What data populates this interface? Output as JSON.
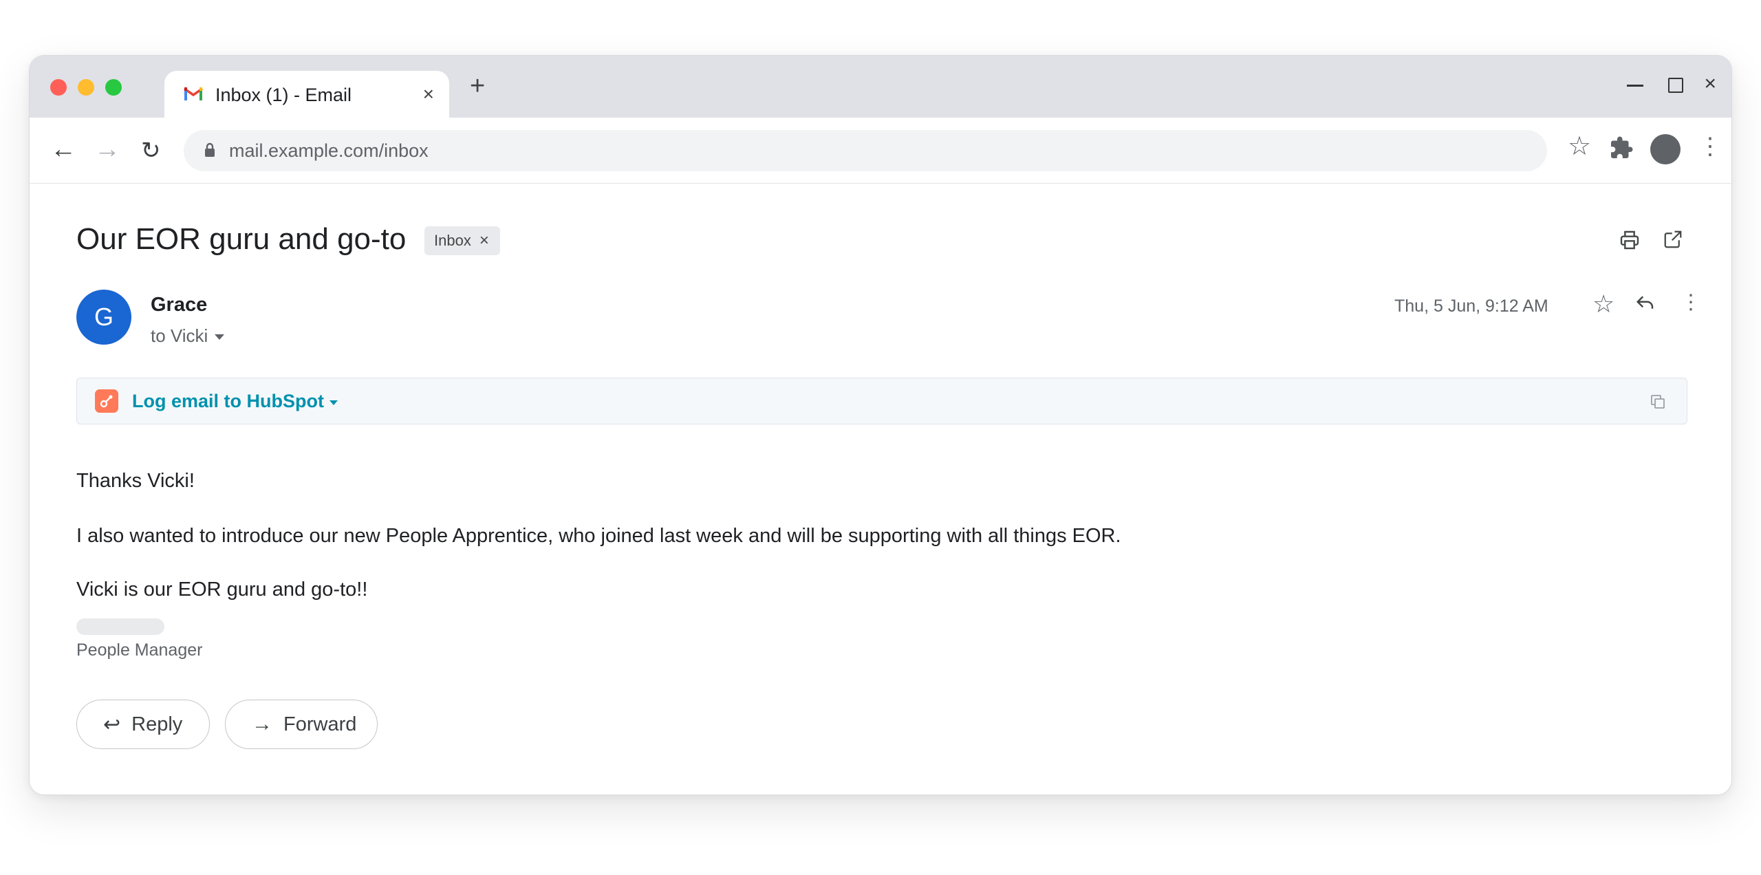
{
  "browser": {
    "tab_title": "Inbox (1) - Email",
    "tab_close": "×",
    "new_tab": "+",
    "window_close": "×",
    "url": "mail.example.com/inbox",
    "nav": {
      "back": "←",
      "forward": "→",
      "reload": "↻"
    },
    "toolbar": {
      "star": "☆",
      "menu": "⋮"
    }
  },
  "email": {
    "subject": "Our EOR guru and go-to",
    "label": "Inbox",
    "label_remove": "×",
    "sender": {
      "initial": "G",
      "name": "Grace",
      "avatar_color": "#1a66d2"
    },
    "recipient": "to Vicki",
    "timestamp": "Thu, 5 Jun, 9:12 AM",
    "star": "☆",
    "more": "⋮",
    "hubspot": {
      "label": "Log email to HubSpot",
      "icon_color": "#ff7a59",
      "text_color": "#0091ae"
    },
    "body": [
      "Thanks Vicki!",
      "I also wanted to introduce our new People Apprentice, who joined last week and will be supporting with all things EOR.",
      "Vicki is our EOR guru and go-to!!"
    ],
    "signature_title": "People Manager",
    "actions": {
      "reply": {
        "icon": "↩",
        "label": "Reply"
      },
      "forward": {
        "icon": "→",
        "label": "Forward"
      }
    }
  }
}
